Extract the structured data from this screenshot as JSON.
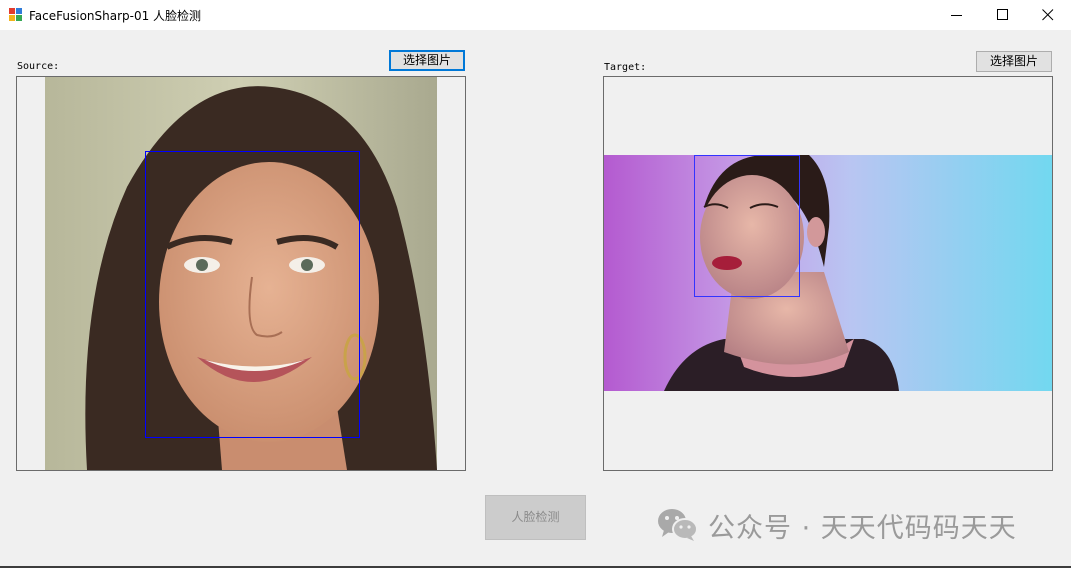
{
  "window": {
    "title": "FaceFusionSharp-01 人脸检测",
    "icon": "windows-forms-app-icon",
    "controls": [
      "minimize-icon",
      "maximize-icon",
      "close-icon"
    ]
  },
  "source": {
    "label": "Source:",
    "select_button": "选择图片",
    "image_description": "portrait photo of a smiling woman with long dark hair",
    "face_box_color": "#0000ff"
  },
  "target": {
    "label": "Target:",
    "select_button": "选择图片",
    "image_description": "portrait of a woman with red lipstick in front of a pink-to-cyan gradient backdrop",
    "face_box_color": "#0000ff"
  },
  "detect_button": {
    "label": "人脸检测",
    "enabled": false
  },
  "watermark": {
    "icon": "wechat-icon",
    "text": "公众号 · 天天代码码天天"
  }
}
